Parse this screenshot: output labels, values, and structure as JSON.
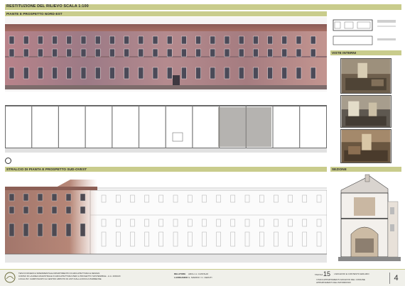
{
  "header": {
    "title": "RESTITUZIONE DEL RILIEVO SCALA 1:100",
    "north_east_label": "PIANTE E PROSPETTO NORD-EST",
    "interior_views_label": "VISTE INTERNI",
    "south_west_label": "STRALCIO DI PIANTA E PROSPETTO SUD-OVEST",
    "section_label": "SEZIONE"
  },
  "footer": {
    "course_lines": [
      "TESI DI RICERCA SPERIMENTALE DIPARTIMENTO DI ARCHITETTURA E DESIGN",
      "CORSO DI LAUREA MAGISTRALE IN ARCHITETTURA PER IL PROGETTO SOSTENIBILE - A.A. 2019/20",
      "LOCALITA' CAMPOSANTO E CENTRO ABITATO DI ASTI DALLA ROCCA PARMENSE"
    ],
    "advisor_label": "RELATORE",
    "advisor_name": "ARCH. A. CASTALDI",
    "candidate_label": "LAUREANDO",
    "candidate_name": "G. MARINO / C. CERUTI",
    "sheet_label": "TAVOLA",
    "sheet_number": "15",
    "project_lines": [
      "I ARCHIVIO E CONTESTO EDILIZIO",
      "I PIANI APPARTAMENTI ARCHIVIO DEL COMUNE",
      "APPARTAMENTI DEL PATRIMONIO"
    ],
    "page_number": "4"
  }
}
